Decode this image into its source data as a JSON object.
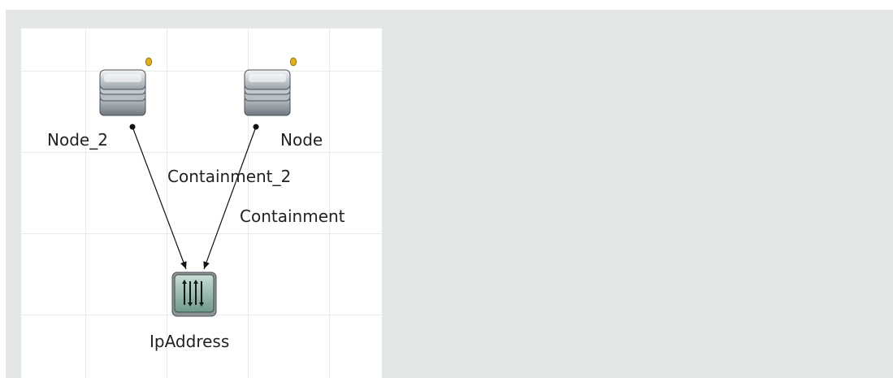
{
  "diagram": {
    "nodes": [
      {
        "id": "node2",
        "label": "Node_2",
        "type": "server",
        "has_indicator": true
      },
      {
        "id": "node",
        "label": "Node",
        "type": "server",
        "has_indicator": true
      },
      {
        "id": "ip",
        "label": "IpAddress",
        "type": "ip-address"
      }
    ],
    "edges": [
      {
        "id": "e1",
        "from": "node2",
        "to": "ip",
        "label": "Containment_2"
      },
      {
        "id": "e2",
        "from": "node",
        "to": "ip",
        "label": "Containment"
      }
    ]
  },
  "colors": {
    "panel_bg": "#e4e7e8",
    "grid_line": "#e9eaeb",
    "indicator": "#e0b020",
    "edge": "#111111"
  }
}
